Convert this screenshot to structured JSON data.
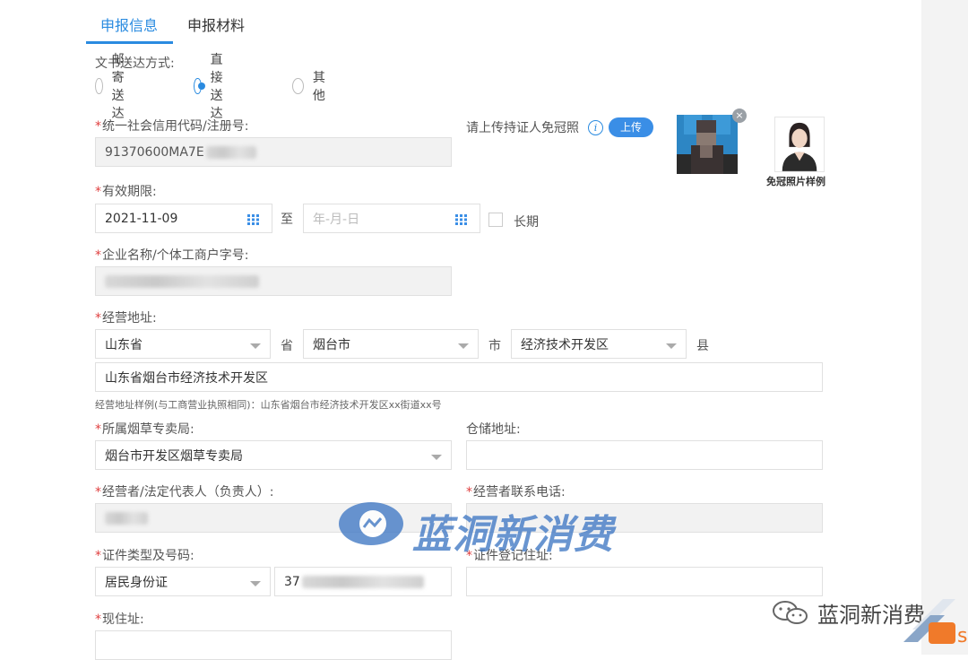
{
  "tabs": [
    {
      "label": "申报信息",
      "active": true
    },
    {
      "label": "申报材料",
      "active": false
    }
  ],
  "delivery": {
    "label": "文书送达方式:",
    "options": [
      "邮寄送达",
      "直接送达",
      "其他"
    ],
    "selected": "直接送达"
  },
  "credit_code": {
    "label": "统一社会信用代码/注册号:",
    "value": "91370600MA7E"
  },
  "upload": {
    "label": "请上传持证人免冠照",
    "button": "上传",
    "sample_caption": "免冠照片样例"
  },
  "validity": {
    "label": "有效期限:",
    "start": "2021-11-09",
    "to": "至",
    "end_placeholder": "年-月-日",
    "long_term": "长期"
  },
  "company_name": {
    "label": "企业名称/个体工商户字号:"
  },
  "address": {
    "label": "经营地址:",
    "province": "山东省",
    "province_unit": "省",
    "city": "烟台市",
    "city_unit": "市",
    "county": "经济技术开发区",
    "county_unit": "县",
    "detail": "山东省烟台市经济技术开发区",
    "hint": "经营地址样例(与工商营业执照相同)：山东省烟台市经济技术开发区xx街道xx号"
  },
  "bureau": {
    "label": "所属烟草专卖局:",
    "value": "烟台市开发区烟草专卖局"
  },
  "storage": {
    "label": "仓储地址:"
  },
  "operator": {
    "label": "经营者/法定代表人（负责人）:"
  },
  "phone": {
    "label": "经营者联系电话:"
  },
  "id_doc": {
    "label": "证件类型及号码:",
    "type": "居民身份证",
    "number": "37"
  },
  "id_address": {
    "label": "证件登记住址:"
  },
  "current_address": {
    "label": "现住址:"
  },
  "watermark": {
    "text": "蓝洞新消费",
    "corner_text": "蓝洞新消费"
  },
  "colors": {
    "accent": "#2a8be0",
    "required": "#e04040"
  }
}
